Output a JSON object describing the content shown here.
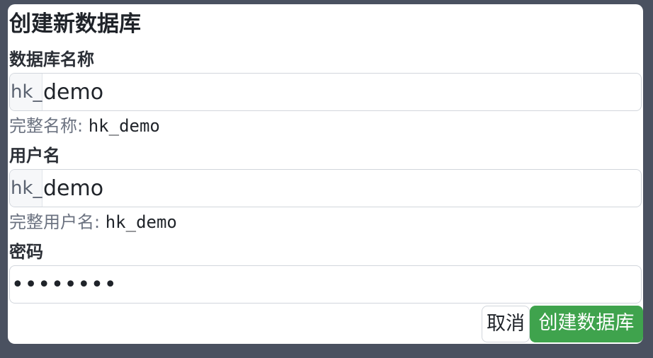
{
  "dialog": {
    "title": "创建新数据库",
    "db_name": {
      "label": "数据库名称",
      "prefix": "hk_",
      "value": "demo",
      "full_label": "完整名称:",
      "full_value": "hk_demo"
    },
    "username": {
      "label": "用户名",
      "prefix": "hk_",
      "value": "demo",
      "full_label": "完整用户名:",
      "full_value": "hk_demo"
    },
    "password": {
      "label": "密码",
      "value": "••••••••"
    },
    "buttons": {
      "cancel": "取消",
      "create": "创建数据库"
    },
    "colors": {
      "primary": "#3fa34d",
      "backdrop": "#4a5160"
    }
  }
}
